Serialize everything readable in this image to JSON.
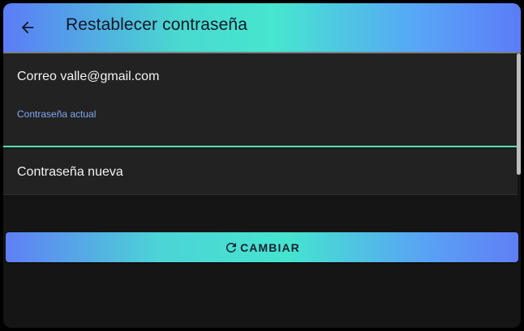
{
  "app_bar": {
    "back_icon": "arrow-left-icon",
    "title": "Restablecer contraseña",
    "gradient": [
      "#5b7cf7",
      "#46e6cf",
      "#5b7cf7"
    ]
  },
  "form": {
    "email_text": "Correo valle@gmail.com",
    "current_password": {
      "label": "Contraseña actual",
      "value": "",
      "focused": true,
      "focus_color": "#53e0b0"
    },
    "new_password": {
      "placeholder": "Contraseña nueva",
      "value": ""
    }
  },
  "button": {
    "icon": "refresh-icon",
    "label": "CAMBIAR"
  },
  "colors": {
    "background": "#151515",
    "panel": "#222222",
    "label_accent": "#7fa9f5"
  }
}
